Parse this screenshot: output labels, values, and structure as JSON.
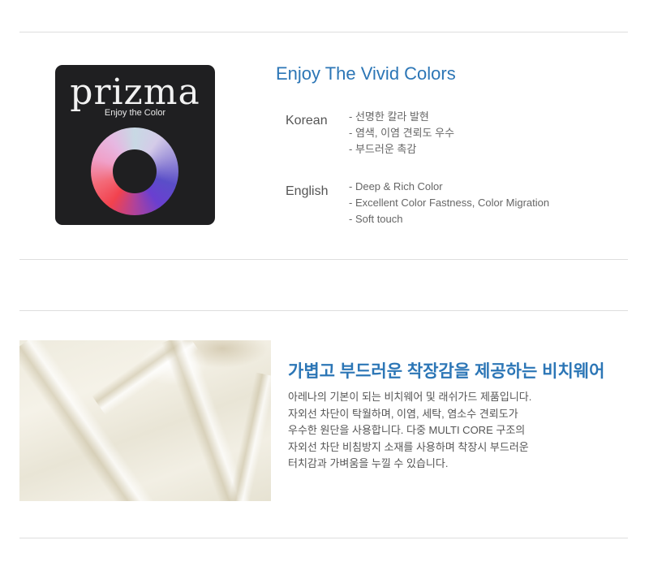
{
  "brand": {
    "logo_text": "prizma",
    "logo_tagline": "Enjoy the Color"
  },
  "section1": {
    "heading": "Enjoy The Vivid Colors",
    "korean": {
      "label": "Korean",
      "items": [
        "선명한 칼라 발현",
        "염색, 이염 견뢰도 우수",
        "부드러운 촉감"
      ]
    },
    "english": {
      "label": "English",
      "items": [
        "Deep & Rich Color",
        "Excellent Color Fastness, Color Migration",
        "Soft touch"
      ]
    }
  },
  "section2": {
    "heading": "가볍고 부드러운 착장감을 제공하는 비치웨어",
    "lines": [
      "아레나의 기본이 되는 비치웨어 및 래쉬가드 제품입니다.",
      "자외선 차단이 탁월하며, 이염, 세탁, 염소수 견뢰도가",
      "우수한 원단을 사용합니다. 다중 MULTI CORE 구조의",
      "자외선 차단 비침방지 소재를 사용하며 착장시 부드러운",
      "터치감과 가벼움을 누낄 수 있습니다."
    ]
  },
  "colors": {
    "accent": "#2c76b6",
    "logo_background": "#1f1f21",
    "divider": "#dedede"
  }
}
